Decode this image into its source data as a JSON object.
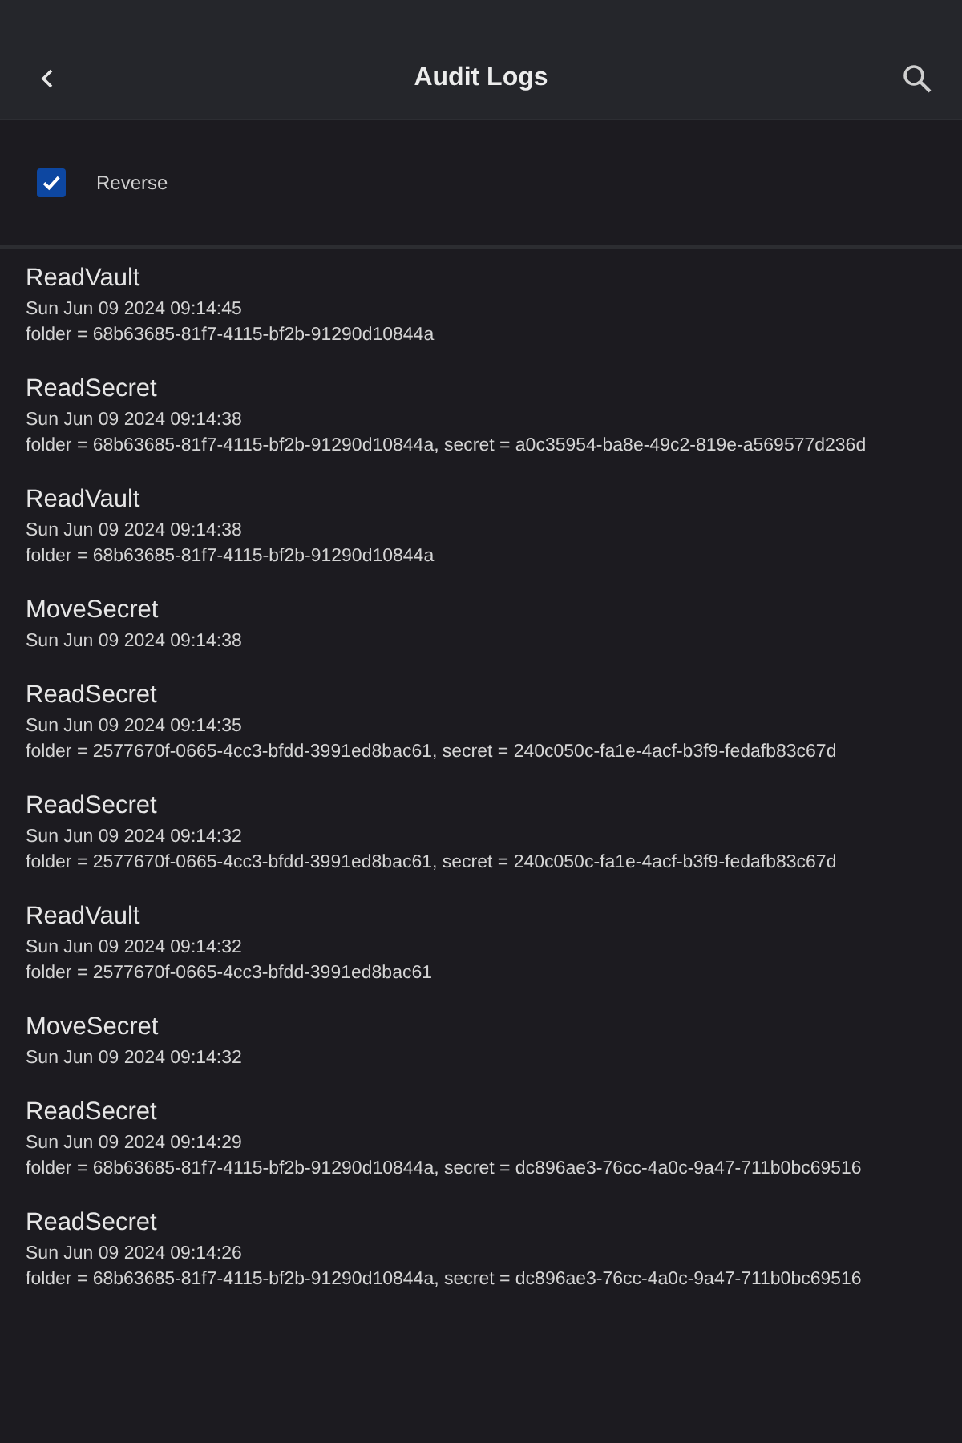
{
  "header": {
    "title": "Audit Logs"
  },
  "options": [
    {
      "label": "Reverse",
      "checked": true
    }
  ],
  "entries": [
    {
      "action": "ReadVault",
      "time": "Sun Jun 09 2024 09:14:45",
      "detail": "folder = 68b63685-81f7-4115-bf2b-91290d10844a"
    },
    {
      "action": "ReadSecret",
      "time": "Sun Jun 09 2024 09:14:38",
      "detail": "folder = 68b63685-81f7-4115-bf2b-91290d10844a, secret = a0c35954-ba8e-49c2-819e-a569577d236d"
    },
    {
      "action": "ReadVault",
      "time": "Sun Jun 09 2024 09:14:38",
      "detail": "folder = 68b63685-81f7-4115-bf2b-91290d10844a"
    },
    {
      "action": "MoveSecret",
      "time": "Sun Jun 09 2024 09:14:38"
    },
    {
      "action": "ReadSecret",
      "time": "Sun Jun 09 2024 09:14:35",
      "detail": "folder = 2577670f-0665-4cc3-bfdd-3991ed8bac61, secret = 240c050c-fa1e-4acf-b3f9-fedafb83c67d"
    },
    {
      "action": "ReadSecret",
      "time": "Sun Jun 09 2024 09:14:32",
      "detail": "folder = 2577670f-0665-4cc3-bfdd-3991ed8bac61, secret = 240c050c-fa1e-4acf-b3f9-fedafb83c67d"
    },
    {
      "action": "ReadVault",
      "time": "Sun Jun 09 2024 09:14:32",
      "detail": "folder = 2577670f-0665-4cc3-bfdd-3991ed8bac61"
    },
    {
      "action": "MoveSecret",
      "time": "Sun Jun 09 2024 09:14:32"
    },
    {
      "action": "ReadSecret",
      "time": "Sun Jun 09 2024 09:14:29",
      "detail": "folder = 68b63685-81f7-4115-bf2b-91290d10844a, secret = dc896ae3-76cc-4a0c-9a47-711b0bc69516"
    },
    {
      "action": "ReadSecret",
      "time": "Sun Jun 09 2024 09:14:26",
      "detail": "folder = 68b63685-81f7-4115-bf2b-91290d10844a, secret = dc896ae3-76cc-4a0c-9a47-711b0bc69516"
    }
  ]
}
